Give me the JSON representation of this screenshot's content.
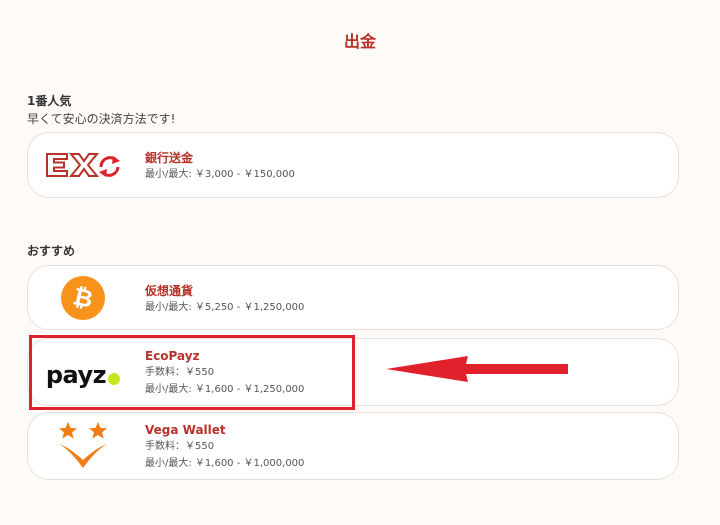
{
  "page": {
    "title": "出金"
  },
  "popular": {
    "heading": "1番人気",
    "subheading": "早くて安心の決済方法です!",
    "methods": [
      {
        "name": "銀行送金",
        "limits": "最小/最大: ￥3,000 - ￥150,000",
        "logo_icon": "ex-bank-transfer-icon"
      }
    ]
  },
  "recommended": {
    "heading": "おすすめ",
    "methods": [
      {
        "name": "仮想通貨",
        "limits": "最小/最大: ￥5,250 - ￥1,250,000",
        "logo_icon": "bitcoin-icon"
      },
      {
        "name": "EcoPayz",
        "fee": "手数料：￥550",
        "limits": "最小/最大: ￥1,600 - ￥1,250,000",
        "logo_icon": "payz-logo-icon",
        "logo_text": "payz"
      },
      {
        "name": "Vega Wallet",
        "fee": "手数料：￥550",
        "limits": "最小/最大: ￥1,600 - ￥1,000,000",
        "logo_icon": "vega-wallet-icon"
      }
    ]
  },
  "annotation": {
    "highlight_color": "#e0202a",
    "arrow_color": "#e0202a"
  },
  "colors": {
    "accent": "#b8322a",
    "bitcoin": "#f7931a",
    "vega": "#f07c14",
    "payz_dot": "#c6e619"
  }
}
